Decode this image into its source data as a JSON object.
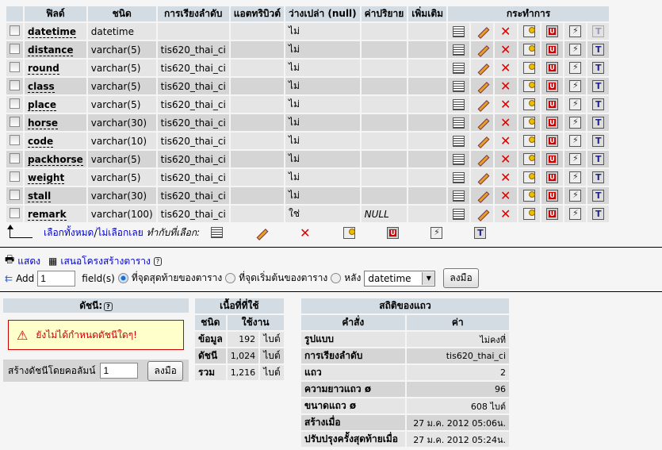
{
  "headers": [
    "ฟิลด์",
    "ชนิด",
    "การเรียงลำดับ",
    "แอตทริบิวต์",
    "ว่างเปล่า (null)",
    "ค่าปริยาย",
    "เพิ่มเติม",
    "กระทำการ"
  ],
  "rows": [
    {
      "field": "datetime",
      "type": "datetime",
      "collation": "",
      "attributes": "",
      "null": "ไม่",
      "default": "",
      "extra": "",
      "fulltext_disabled": true
    },
    {
      "field": "distance",
      "type": "varchar(5)",
      "collation": "tis620_thai_ci",
      "attributes": "",
      "null": "ไม่",
      "default": "",
      "extra": ""
    },
    {
      "field": "round",
      "type": "varchar(5)",
      "collation": "tis620_thai_ci",
      "attributes": "",
      "null": "ไม่",
      "default": "",
      "extra": ""
    },
    {
      "field": "class",
      "type": "varchar(5)",
      "collation": "tis620_thai_ci",
      "attributes": "",
      "null": "ไม่",
      "default": "",
      "extra": ""
    },
    {
      "field": "place",
      "type": "varchar(5)",
      "collation": "tis620_thai_ci",
      "attributes": "",
      "null": "ไม่",
      "default": "",
      "extra": ""
    },
    {
      "field": "horse",
      "type": "varchar(30)",
      "collation": "tis620_thai_ci",
      "attributes": "",
      "null": "ไม่",
      "default": "",
      "extra": ""
    },
    {
      "field": "code",
      "type": "varchar(10)",
      "collation": "tis620_thai_ci",
      "attributes": "",
      "null": "ไม่",
      "default": "",
      "extra": ""
    },
    {
      "field": "packhorse",
      "type": "varchar(5)",
      "collation": "tis620_thai_ci",
      "attributes": "",
      "null": "ไม่",
      "default": "",
      "extra": ""
    },
    {
      "field": "weight",
      "type": "varchar(5)",
      "collation": "tis620_thai_ci",
      "attributes": "",
      "null": "ไม่",
      "default": "",
      "extra": ""
    },
    {
      "field": "stall",
      "type": "varchar(30)",
      "collation": "tis620_thai_ci",
      "attributes": "",
      "null": "ไม่",
      "default": "",
      "extra": ""
    },
    {
      "field": "remark",
      "type": "varchar(100)",
      "collation": "tis620_thai_ci",
      "attributes": "",
      "null": "ใช่",
      "default": "NULL",
      "extra": ""
    }
  ],
  "actions": [
    "browse-icon",
    "edit-icon",
    "drop-icon",
    "primary-key-icon",
    "unique-icon",
    "index-icon",
    "fulltext-icon"
  ],
  "selection": {
    "check_all": "เลือกทั้งหมด",
    "separator": " / ",
    "uncheck_all": "ไม่เลือกเลย",
    "with_selected": "ทำกับที่เลือก:"
  },
  "ops": {
    "print": "แสดง",
    "propose": "เสนอโครงสร้างตาราง",
    "add": "Add",
    "add_count": "1",
    "fields": "field(s)",
    "at_end": "ที่จุดสุดท้ายของตาราง",
    "at_begin": "ที่จุดเริ่มต้นของตาราง",
    "after": "หลัง",
    "after_field": "datetime",
    "go": "ลงมือ"
  },
  "indexes": {
    "title": "ดัชนี:",
    "warning": "ยังไม่ได้กำหนดดัชนีใดๆ!",
    "create_label": "สร้างดัชนีโดยคอลัมน์",
    "create_count": "1",
    "go": "ลงมือ"
  },
  "space": {
    "title": "เนื้อที่ที่ใช้",
    "col_type": "ชนิด",
    "col_usage": "ใช้งาน",
    "rows": [
      {
        "k": "ข้อมูล",
        "v": "192",
        "u": "ไบต์"
      },
      {
        "k": "ดัชนี",
        "v": "1,024",
        "u": "ไบต์"
      },
      {
        "k": "รวม",
        "v": "1,216",
        "u": "ไบต์"
      }
    ]
  },
  "stats": {
    "title": "สถิติของแถว",
    "col_stmt": "คำสั่ง",
    "col_value": "ค่า",
    "rows": [
      {
        "k": "รูปแบบ",
        "v": "ไม่คงที่"
      },
      {
        "k": "การเรียงลำดับ",
        "v": "tis620_thai_ci"
      },
      {
        "k": "แถว",
        "v": "2"
      },
      {
        "k": "ความยาวแถว ø",
        "v": "96"
      },
      {
        "k": "ขนาดแถว ø",
        "v": "608 ไบต์"
      },
      {
        "k": "สร้างเมื่อ",
        "v": "27 ม.ค. 2012 05:06น."
      },
      {
        "k": "ปรับปรุงครั้งสุดท้ายเมื่อ",
        "v": "27 ม.ค. 2012 05:24น."
      }
    ]
  }
}
